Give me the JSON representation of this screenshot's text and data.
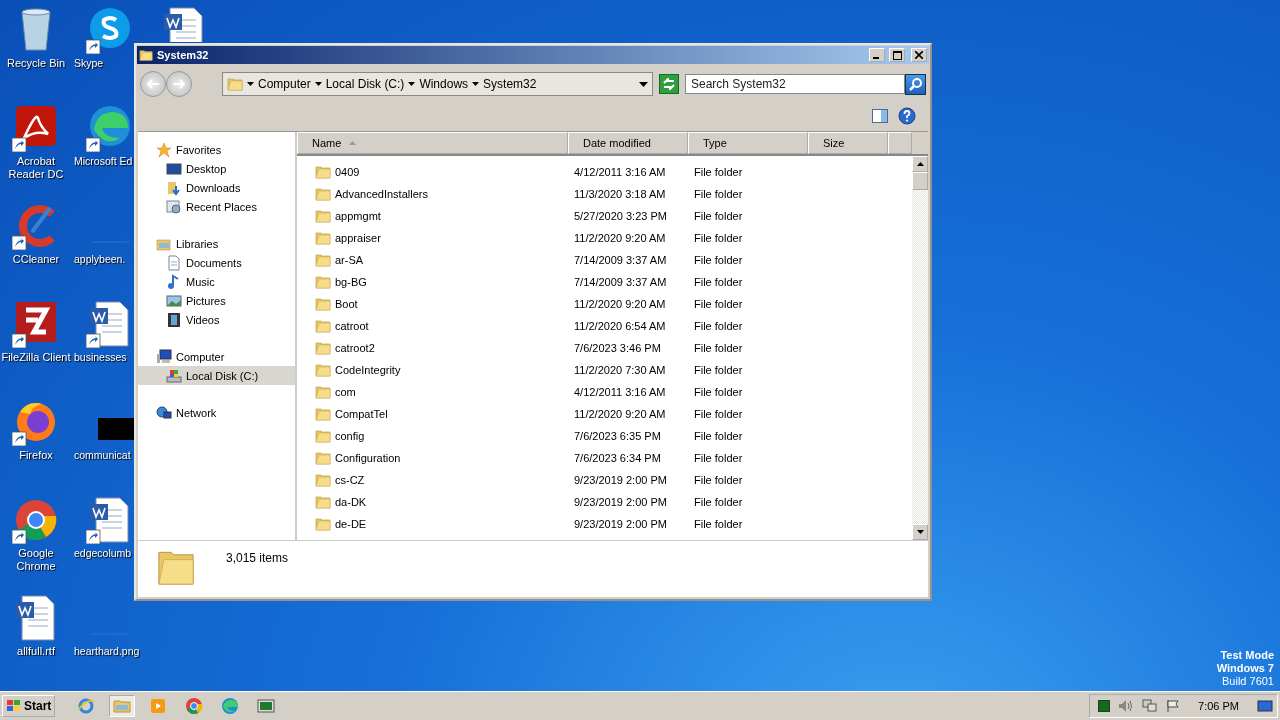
{
  "desktop": {
    "columns": [
      {
        "icons": [
          {
            "label": "Recycle Bin",
            "kind": "recycle-bin",
            "shortcut": false
          },
          {
            "label": "Acrobat Reader DC",
            "kind": "acrobat",
            "shortcut": true
          },
          {
            "label": "CCleaner",
            "kind": "ccleaner",
            "shortcut": true
          },
          {
            "label": "FileZilla Client",
            "kind": "filezilla",
            "shortcut": true
          },
          {
            "label": "Firefox",
            "kind": "firefox",
            "shortcut": true
          },
          {
            "label": "Google Chrome",
            "kind": "chrome",
            "shortcut": true
          },
          {
            "label": "allfull.rtf",
            "kind": "word",
            "shortcut": false
          }
        ]
      },
      {
        "icons": [
          {
            "label": "Skype",
            "kind": "skype",
            "shortcut": true
          },
          {
            "label": "Microsoft Ed",
            "kind": "edge",
            "shortcut": true
          },
          {
            "label": "applybeen.",
            "kind": "blank",
            "shortcut": false
          },
          {
            "label": "businesses",
            "kind": "word",
            "shortcut": true
          },
          {
            "label": "communicat",
            "kind": "black",
            "shortcut": false
          },
          {
            "label": "edgecolumb",
            "kind": "word",
            "shortcut": true
          },
          {
            "label": "hearthard.png",
            "kind": "blank",
            "shortcut": false
          }
        ]
      },
      {
        "icons": [
          {
            "kind": "word",
            "shortcut": false
          }
        ]
      }
    ],
    "system_text": [
      "Test Mode",
      "Windows 7",
      "Build 7601"
    ]
  },
  "window": {
    "title": "System32",
    "address": {
      "crumbs": [
        "Computer",
        "Local Disk (C:)",
        "Windows",
        "System32"
      ]
    },
    "search": {
      "placeholder": "Search System32"
    },
    "nav": [
      {
        "label": "Favorites",
        "kind": "star",
        "selected": false,
        "children": [
          {
            "label": "Desktop",
            "kind": "desktop",
            "selected": false
          },
          {
            "label": "Downloads",
            "kind": "downloads",
            "selected": false
          },
          {
            "label": "Recent Places",
            "kind": "recent",
            "selected": false
          }
        ]
      },
      {
        "label": "Libraries",
        "kind": "libraries",
        "selected": false,
        "children": [
          {
            "label": "Documents",
            "kind": "documents",
            "selected": false
          },
          {
            "label": "Music",
            "kind": "music",
            "selected": false
          },
          {
            "label": "Pictures",
            "kind": "pictures",
            "selected": false
          },
          {
            "label": "Videos",
            "kind": "videos",
            "selected": false
          }
        ]
      },
      {
        "label": "Computer",
        "kind": "computer",
        "selected": false,
        "children": [
          {
            "label": "Local Disk (C:)",
            "kind": "drive",
            "selected": true
          }
        ]
      },
      {
        "label": "Network",
        "kind": "network",
        "selected": false
      }
    ],
    "table": {
      "columns": [
        {
          "label": "Name",
          "sorted": true
        },
        {
          "label": "Date modified",
          "sorted": false
        },
        {
          "label": "Type",
          "sorted": false
        },
        {
          "label": "Size",
          "sorted": false
        }
      ],
      "rows": [
        {
          "name": "0409",
          "date": "4/12/2011 3:16 AM",
          "type": "File folder"
        },
        {
          "name": "AdvancedInstallers",
          "date": "11/3/2020 3:18 AM",
          "type": "File folder"
        },
        {
          "name": "appmgmt",
          "date": "5/27/2020 3:23 PM",
          "type": "File folder"
        },
        {
          "name": "appraiser",
          "date": "11/2/2020 9:20 AM",
          "type": "File folder"
        },
        {
          "name": "ar-SA",
          "date": "7/14/2009 3:37 AM",
          "type": "File folder"
        },
        {
          "name": "bg-BG",
          "date": "7/14/2009 3:37 AM",
          "type": "File folder"
        },
        {
          "name": "Boot",
          "date": "11/2/2020 9:20 AM",
          "type": "File folder"
        },
        {
          "name": "catroot",
          "date": "11/2/2020 6:54 AM",
          "type": "File folder"
        },
        {
          "name": "catroot2",
          "date": "7/6/2023 3:46 PM",
          "type": "File folder"
        },
        {
          "name": "CodeIntegrity",
          "date": "11/2/2020 7:30 AM",
          "type": "File folder"
        },
        {
          "name": "com",
          "date": "4/12/2011 3:16 AM",
          "type": "File folder"
        },
        {
          "name": "CompatTel",
          "date": "11/2/2020 9:20 AM",
          "type": "File folder"
        },
        {
          "name": "config",
          "date": "7/6/2023 6:35 PM",
          "type": "File folder"
        },
        {
          "name": "Configuration",
          "date": "7/6/2023 6:34 PM",
          "type": "File folder"
        },
        {
          "name": "cs-CZ",
          "date": "9/23/2019 2:00 PM",
          "type": "File folder"
        },
        {
          "name": "da-DK",
          "date": "9/23/2019 2:00 PM",
          "type": "File folder"
        },
        {
          "name": "de-DE",
          "date": "9/23/2019 2:00 PM",
          "type": "File folder"
        }
      ]
    },
    "details": {
      "count": "3,015 items"
    }
  },
  "taskbar": {
    "start": "Start",
    "apps": [
      {
        "kind": "ie",
        "selected": false
      },
      {
        "kind": "explorer",
        "selected": true
      },
      {
        "kind": "media",
        "selected": false
      },
      {
        "kind": "chrome",
        "selected": false
      },
      {
        "kind": "edge",
        "selected": false
      },
      {
        "kind": "terminal",
        "selected": false
      }
    ],
    "clock": "7:06 PM"
  }
}
